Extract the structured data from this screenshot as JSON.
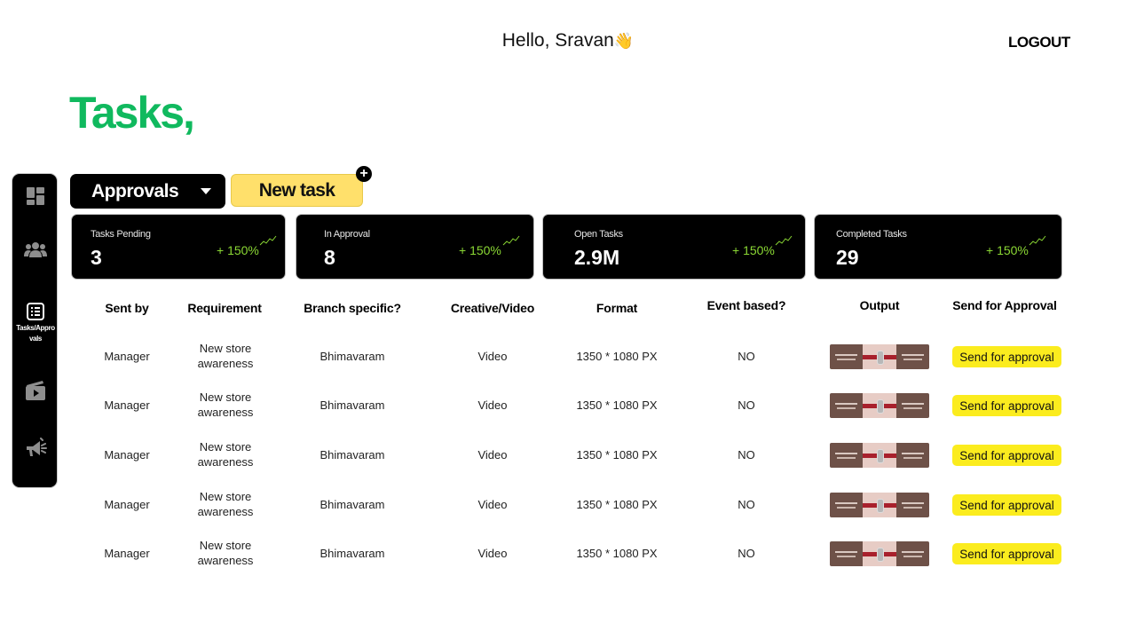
{
  "header": {
    "greeting": "Hello, Sravan",
    "wave_emoji": "👋",
    "logout_label": "LOGOUT"
  },
  "page": {
    "title": "Tasks,"
  },
  "sidebar": {
    "items": [
      {
        "icon": "dashboard-icon",
        "label": ""
      },
      {
        "icon": "users-icon",
        "label": ""
      },
      {
        "icon": "task-list-icon",
        "label": "Tasks/Approvals"
      },
      {
        "icon": "media-icon",
        "label": ""
      },
      {
        "icon": "megaphone-icon",
        "label": ""
      }
    ]
  },
  "toolbar": {
    "dropdown_value": "Approvals",
    "new_task_label": "New task",
    "plus_glyph": "+"
  },
  "stats": [
    {
      "label": "Tasks Pending",
      "value": "3",
      "delta": "+ 150%"
    },
    {
      "label": "In Approval",
      "value": "8",
      "delta": "+ 150%"
    },
    {
      "label": "Open Tasks",
      "value": "2.9M",
      "delta": "+ 150%"
    },
    {
      "label": "Completed Tasks",
      "value": "29",
      "delta": "+ 150%"
    }
  ],
  "table": {
    "headers": [
      "Sent by",
      "Requirement",
      "Branch specific?",
      "Creative/Video",
      "Format",
      "Event based?",
      "Output",
      "Send for Approval"
    ],
    "rows": [
      {
        "sent_by": "Manager",
        "requirement": "New store awareness",
        "branch": "Bhimavaram",
        "type": "Video",
        "format": "1350 * 1080 PX",
        "event": "NO",
        "action": "Send for approval"
      },
      {
        "sent_by": "Manager",
        "requirement": "New store awareness",
        "branch": "Bhimavaram",
        "type": "Video",
        "format": "1350 * 1080 PX",
        "event": "NO",
        "action": "Send for approval"
      },
      {
        "sent_by": "Manager",
        "requirement": "New store awareness",
        "branch": "Bhimavaram",
        "type": "Video",
        "format": "1350 * 1080 PX",
        "event": "NO",
        "action": "Send for approval"
      },
      {
        "sent_by": "Manager",
        "requirement": "New store awareness",
        "branch": "Bhimavaram",
        "type": "Video",
        "format": "1350 * 1080 PX",
        "event": "NO",
        "action": "Send for approval"
      },
      {
        "sent_by": "Manager",
        "requirement": "New store awareness",
        "branch": "Bhimavaram",
        "type": "Video",
        "format": "1350 * 1080 PX",
        "event": "NO",
        "action": "Send for approval"
      }
    ]
  },
  "colors": {
    "title_green": "#10b95e",
    "accent_yellow": "#ffe06b",
    "button_yellow": "#fbec1e",
    "delta_green": "#8bd834",
    "card_black": "#000000"
  }
}
